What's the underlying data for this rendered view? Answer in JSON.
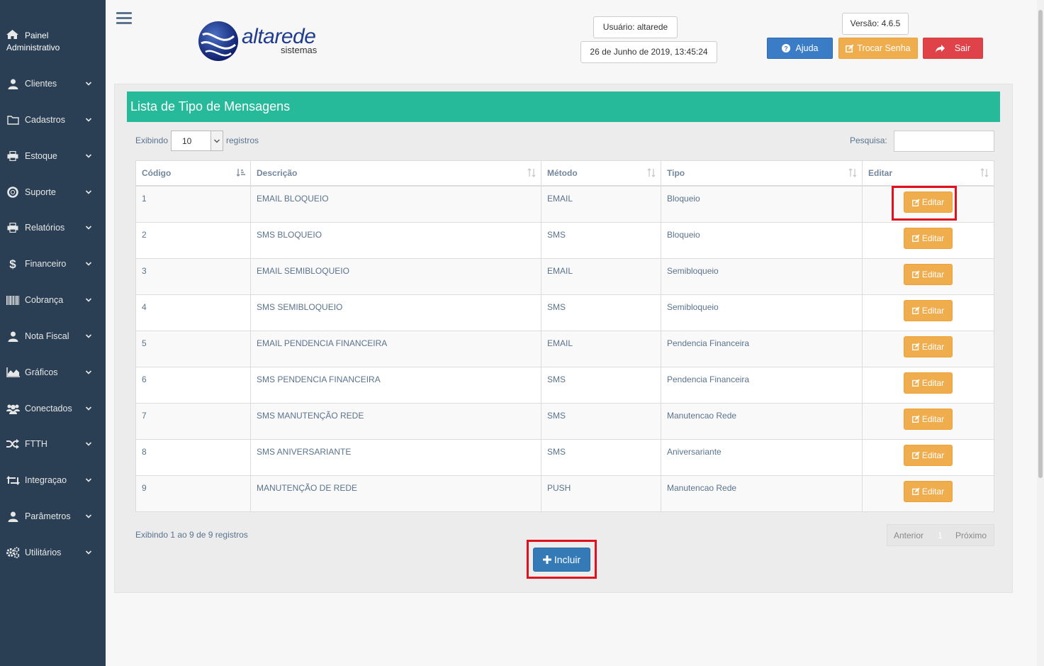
{
  "sidebar": {
    "title_line1": "Painel",
    "title_line2": "Administrativo",
    "items": [
      {
        "label": "Clientes",
        "icon": "user-icon"
      },
      {
        "label": "Cadastros",
        "icon": "folder-icon"
      },
      {
        "label": "Estoque",
        "icon": "print-icon"
      },
      {
        "label": "Suporte",
        "icon": "lifebuoy-icon"
      },
      {
        "label": "Relatórios",
        "icon": "print-icon"
      },
      {
        "label": "Financeiro",
        "icon": "dollar-icon"
      },
      {
        "label": "Cobrança",
        "icon": "barcode-icon"
      },
      {
        "label": "Nota Fiscal",
        "icon": "user-icon"
      },
      {
        "label": "Gráficos",
        "icon": "area-chart-icon"
      },
      {
        "label": "Conectados",
        "icon": "users-icon"
      },
      {
        "label": "FTTH",
        "icon": "random-icon"
      },
      {
        "label": "Integraçao",
        "icon": "retweet-icon"
      },
      {
        "label": "Parâmetros",
        "icon": "user-icon"
      },
      {
        "label": "Utilitários",
        "icon": "cogs-icon"
      }
    ]
  },
  "header": {
    "logo_main": "altarede",
    "logo_sub": "sistemas",
    "user": "Usuário: altarede",
    "datetime": "26 de Junho de 2019, 13:45:24",
    "version": "Versão: 4.6.5",
    "help_label": "Ajuda",
    "change_password_label": "Trocar Senha",
    "logout_label": "Sair"
  },
  "panel": {
    "title": "Lista de Tipo de Mensagens",
    "show_label": "Exibindo",
    "page_size": "10",
    "records_label": "registros",
    "search_label": "Pesquisa:",
    "search_value": ""
  },
  "table": {
    "columns": [
      "Código",
      "Descrição",
      "Método",
      "Tipo",
      "Editar"
    ],
    "edit_label": "Editar",
    "rows": [
      {
        "codigo": "1",
        "descricao": "EMAIL BLOQUEIO",
        "metodo": "EMAIL",
        "tipo": "Bloqueio"
      },
      {
        "codigo": "2",
        "descricao": "SMS BLOQUEIO",
        "metodo": "SMS",
        "tipo": "Bloqueio"
      },
      {
        "codigo": "3",
        "descricao": "EMAIL SEMIBLOQUEIO",
        "metodo": "EMAIL",
        "tipo": "Semibloqueio"
      },
      {
        "codigo": "4",
        "descricao": "SMS SEMIBLOQUEIO",
        "metodo": "SMS",
        "tipo": "Semibloqueio"
      },
      {
        "codigo": "5",
        "descricao": "EMAIL PENDENCIA FINANCEIRA",
        "metodo": "EMAIL",
        "tipo": "Pendencia Financeira"
      },
      {
        "codigo": "6",
        "descricao": "SMS PENDENCIA FINANCEIRA",
        "metodo": "SMS",
        "tipo": "Pendencia Financeira"
      },
      {
        "codigo": "7",
        "descricao": "SMS MANUTENÇÃO REDE",
        "metodo": "SMS",
        "tipo": "Manutencao Rede"
      },
      {
        "codigo": "8",
        "descricao": "SMS ANIVERSARIANTE",
        "metodo": "SMS",
        "tipo": "Aniversariante"
      },
      {
        "codigo": "9",
        "descricao": "MANUTENÇÃO DE REDE",
        "metodo": "PUSH",
        "tipo": "Manutencao Rede"
      }
    ]
  },
  "footer": {
    "info": "Exibindo 1 ao 9 de 9 registros",
    "prev_label": "Anterior",
    "page": "1",
    "next_label": "Próximo",
    "include_label": "Incluir"
  },
  "colors": {
    "sidebar": "#2a3f54",
    "panel_header": "#26b99a",
    "edit_button": "#f0ad4e",
    "highlight": "#e0101e"
  }
}
